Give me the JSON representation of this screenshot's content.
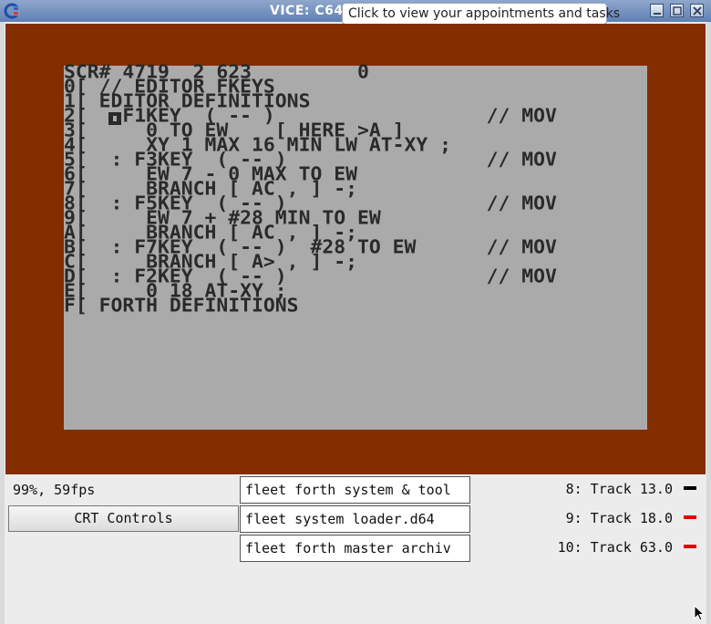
{
  "window": {
    "title": "VICE: C64",
    "icon": "vice-app-icon",
    "tooltip": "Click to view your appointments and tasks",
    "buttons": [
      "minimize-icon",
      "maximize-icon",
      "close-icon"
    ]
  },
  "colors": {
    "c64_border": "#832d00",
    "c64_screen": "#aaaaaa",
    "c64_text": "#2a2a2a",
    "led_active": "#e00000",
    "led_idle": "#000000"
  },
  "screen": {
    "lines": [
      "SCR# 4719  2 623         0",
      "0[ // EDITOR FKEYS",
      "1[ EDITOR DEFINITIONS",
      "2[   F1KEY  ( -- )                  // MOV",
      "3[     0 TO EW    [ HERE >A ]",
      "4[     XY 1 MAX 16 MIN LW AT-XY ;",
      "5[  : F3KEY  ( -- )                 // MOV",
      "6[     EW 7 - 0 MAX TO EW",
      "7[     BRANCH [ AC , ] -;",
      "8[  : F5KEY  ( -- )                 // MOV",
      "9[     EW 7 + #28 MIN TO EW",
      "A[     BRANCH [ AC , ] -;",
      "B[  : F7KEY  ( -- )  #28 TO EW      // MOV",
      "C[     BRANCH [ A> , ] -;",
      "D[  : F2KEY  ( -- )                 // MOV",
      "E[     0 18 AT-XY ;",
      "F[ FORTH DEFINITIONS"
    ]
  },
  "status": {
    "speed": "99%, 59fps",
    "crt_button": "CRT Controls",
    "disks": [
      "fleet forth system & tool",
      "fleet system loader.d64",
      "fleet forth master archiv"
    ],
    "drives": [
      {
        "label": "8: Track 13.0",
        "led": "idle"
      },
      {
        "label": "9: Track 18.0",
        "led": "active"
      },
      {
        "label": "10: Track 63.0",
        "led": "active"
      }
    ]
  }
}
